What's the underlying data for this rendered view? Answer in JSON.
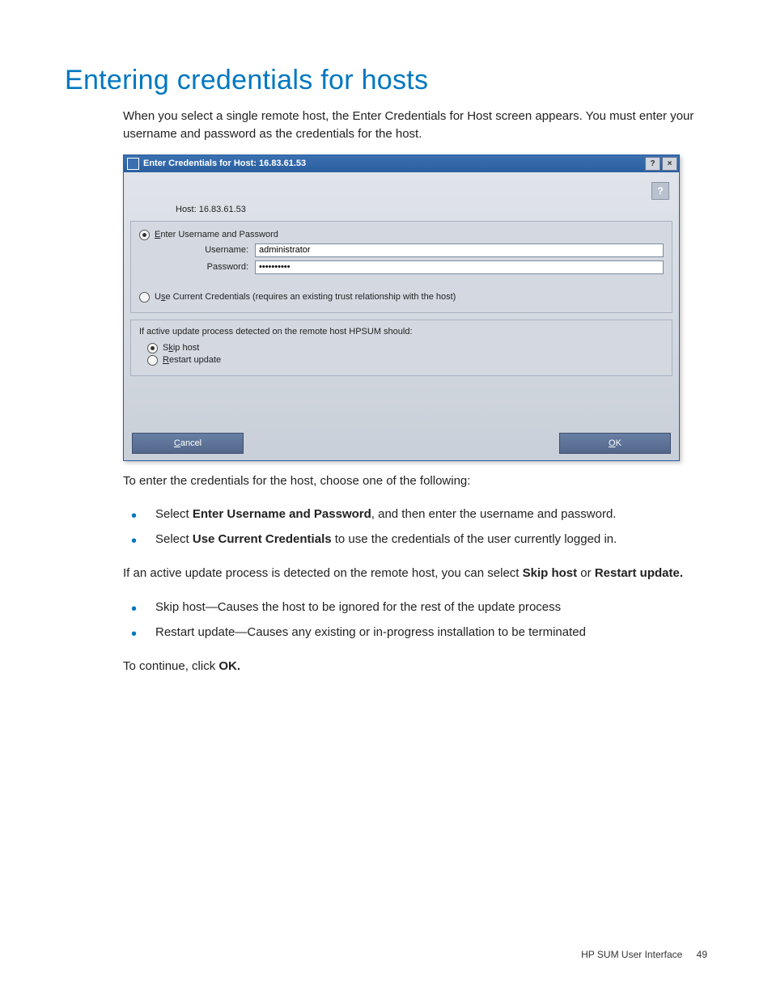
{
  "heading": "Entering credentials for hosts",
  "intro": "When you select a single remote host, the Enter Credentials for Host screen appears. You must enter your username and password as the credentials for the host.",
  "dialog": {
    "title": "Enter Credentials for Host: 16.83.61.53",
    "help_btn": "?",
    "close_char": "×",
    "help_char": "?",
    "host_label": "Host:",
    "host_value": "16.83.61.53",
    "opt_enter": "Enter Username and Password",
    "username_label": "Username:",
    "username_value": "administrator",
    "password_label": "Password:",
    "password_value": "••••••••••",
    "opt_current": "Use Current Credentials (requires an existing trust relationship with the host)",
    "active_note": "If active update process detected on the remote host HPSUM should:",
    "opt_skip": "Skip host",
    "opt_restart": "Restart update",
    "cancel": "Cancel",
    "ok": "OK"
  },
  "post_text": "To enter the credentials for the host, choose one of the following:",
  "bullets1": [
    {
      "pre": "Select ",
      "bold": "Enter Username and Password",
      "post": ", and then enter the username and password."
    },
    {
      "pre": "Select ",
      "bold": "Use Current Credentials",
      "post": " to use the credentials of the user currently logged in."
    }
  ],
  "mid_line_pre": "If an active update process is detected on the remote host, you can select ",
  "mid_bold1": "Skip host",
  "mid_or": " or ",
  "mid_bold2": "Restart update.",
  "bullets2": [
    "Skip host—Causes the host to be ignored for the rest of the update process",
    "Restart update—Causes any existing or in-progress installation to be terminated"
  ],
  "continue_pre": "To continue, click ",
  "continue_bold": "OK.",
  "footer_text": "HP SUM User Interface",
  "footer_page": "49"
}
